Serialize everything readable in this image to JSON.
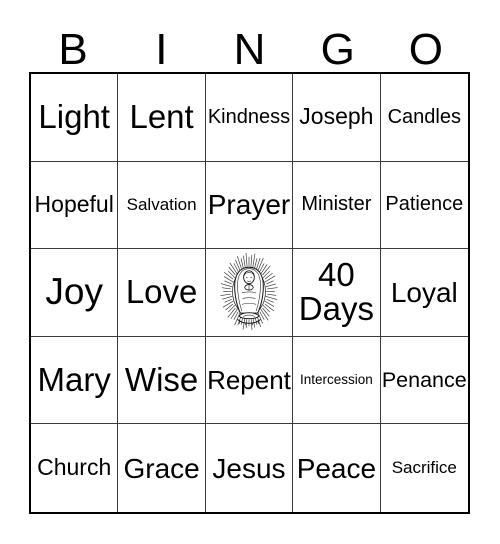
{
  "card": {
    "title_letters": [
      "B",
      "I",
      "N",
      "G",
      "O"
    ],
    "colors": {
      "background": "#ffffff",
      "text": "#000000",
      "outer_border": "#000000",
      "inner_border": "#3a3a3a"
    },
    "grid": {
      "rows": 5,
      "columns": 5,
      "cells": [
        [
          {
            "text": "Light",
            "size": "fs-lg",
            "free": false
          },
          {
            "text": "Lent",
            "size": "fs-lg",
            "free": false
          },
          {
            "text": "Kindness",
            "size": "fs-xs",
            "free": false
          },
          {
            "text": "Joseph",
            "size": "fs-sm",
            "free": false
          },
          {
            "text": "Candles",
            "size": "fs-xs",
            "free": false
          }
        ],
        [
          {
            "text": "Hopeful",
            "size": "fs-sm",
            "free": false
          },
          {
            "text": "Salvation",
            "size": "fs-xxs",
            "free": false
          },
          {
            "text": "Prayer",
            "size": "fs-md",
            "free": false
          },
          {
            "text": "Minister",
            "size": "fs-xs",
            "free": false
          },
          {
            "text": "Patience",
            "size": "fs-xs",
            "free": false
          }
        ],
        [
          {
            "text": "Joy",
            "size": "fs-xl",
            "free": false
          },
          {
            "text": "Love",
            "size": "fs-lg",
            "free": false
          },
          {
            "text": "",
            "size": "fs-md",
            "free": true,
            "image": "our-lady-of-guadalupe"
          },
          {
            "text": "40 Days",
            "size": "fs-lg",
            "free": false
          },
          {
            "text": "Loyal",
            "size": "fs-md",
            "free": false
          }
        ],
        [
          {
            "text": "Mary",
            "size": "fs-lg",
            "free": false
          },
          {
            "text": "Wise",
            "size": "fs-lg",
            "free": false
          },
          {
            "text": "Repent",
            "size": "fs-md",
            "free": false
          },
          {
            "text": "Intercession",
            "size": "fs-tiny",
            "free": false
          },
          {
            "text": "Penance",
            "size": "fs-sm",
            "free": false
          }
        ],
        [
          {
            "text": "Church",
            "size": "fs-sm",
            "free": false
          },
          {
            "text": "Grace",
            "size": "fs-md",
            "free": false
          },
          {
            "text": "Jesus",
            "size": "fs-md",
            "free": false
          },
          {
            "text": "Peace",
            "size": "fs-md",
            "free": false
          },
          {
            "text": "Sacrifice",
            "size": "fs-xxs",
            "free": false
          }
        ]
      ]
    }
  }
}
